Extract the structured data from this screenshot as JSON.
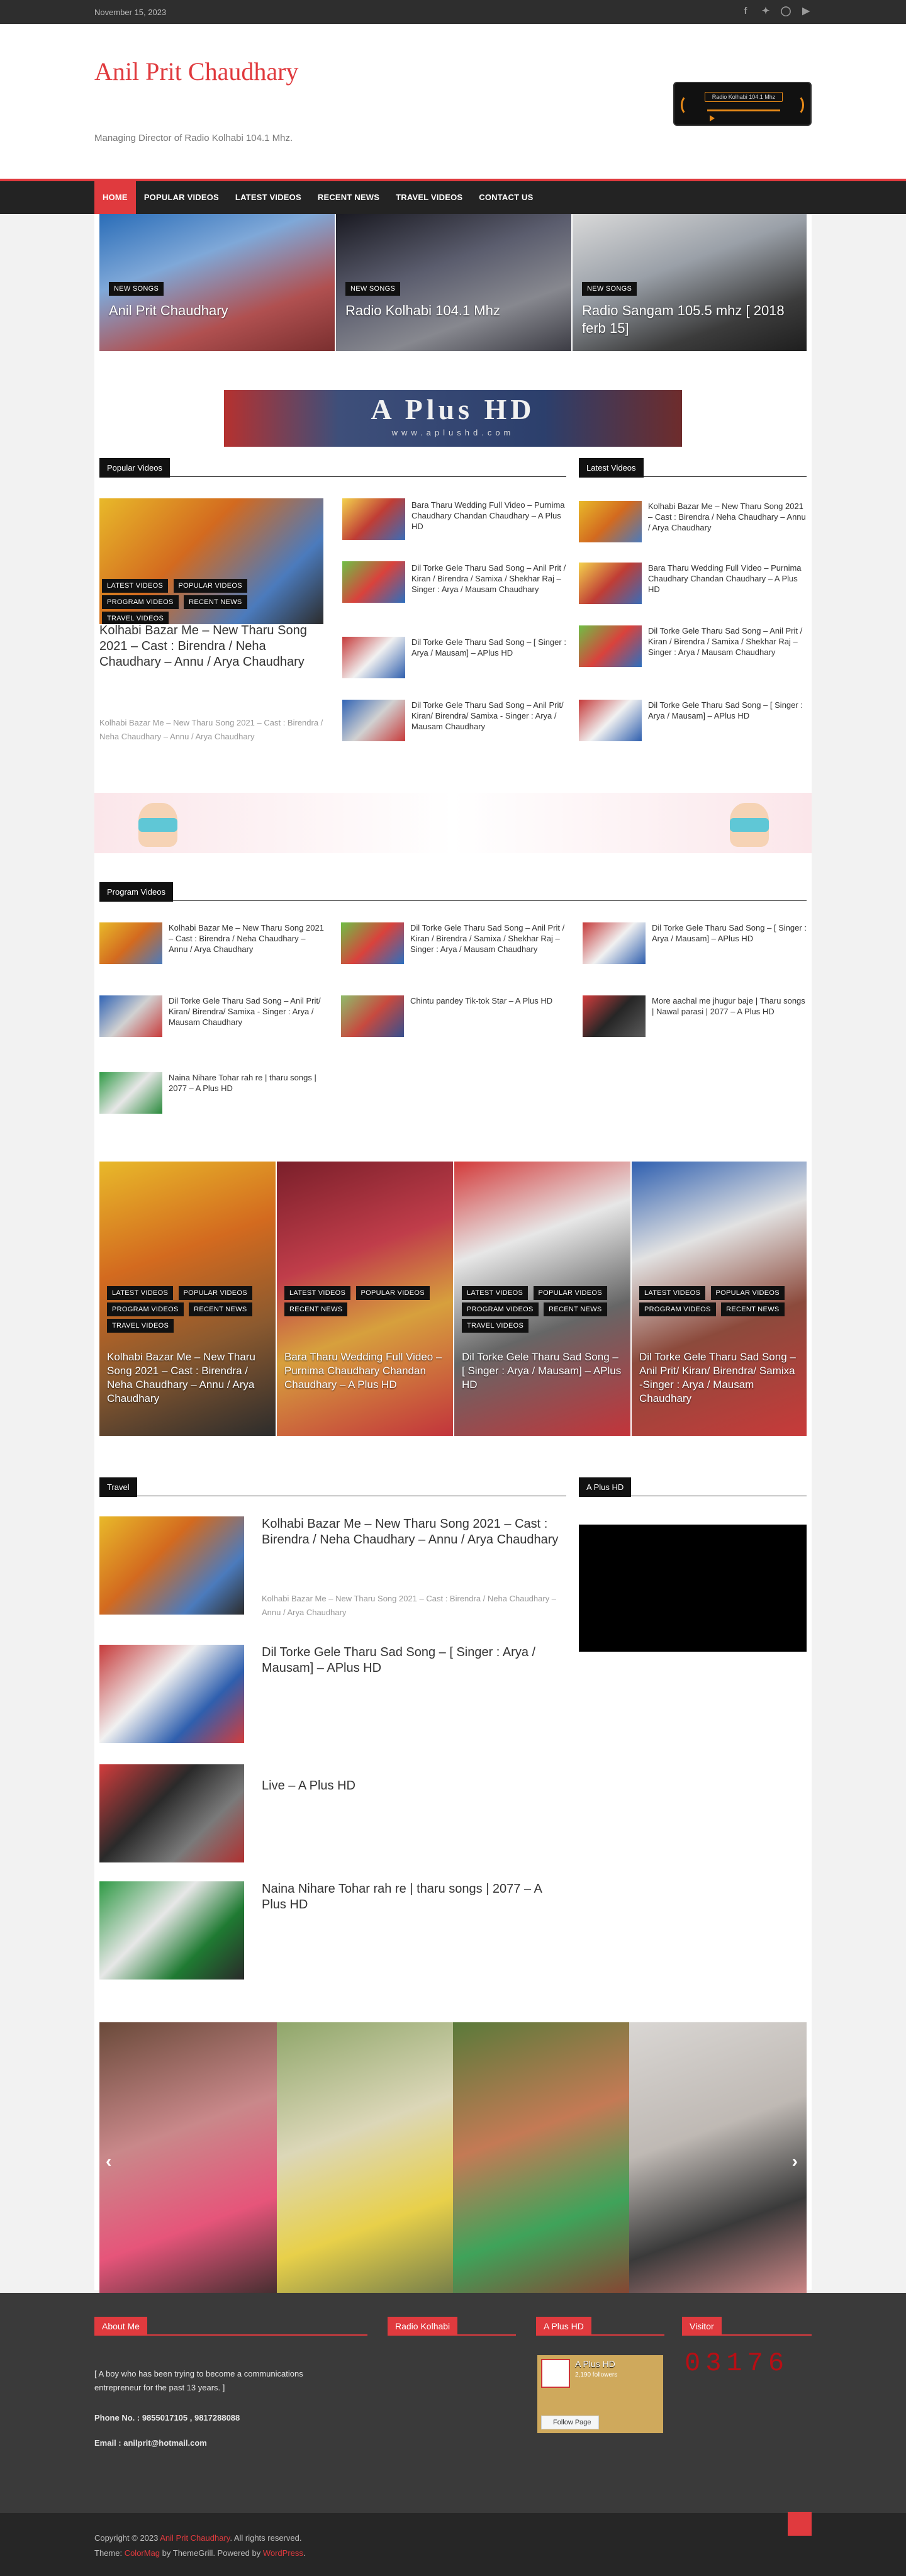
{
  "topbar": {
    "date": "November 15, 2023",
    "social": [
      "facebook-icon",
      "twitter-icon",
      "instagram-icon",
      "youtube-icon"
    ]
  },
  "header": {
    "title": "Anil Prit Chaudhary",
    "description": "Managing Director of Radio Kolhabi 104.1 Mhz.",
    "radio_label": "Radio Kolhabi 104.1 Mhz"
  },
  "nav": [
    "HOME",
    "POPULAR VIDEOS",
    "LATEST VIDEOS",
    "RECENT NEWS",
    "TRAVEL VIDEOS",
    "CONTACT US"
  ],
  "featured": [
    {
      "tag": "NEW SONGS",
      "title": "Anil Prit Chaudhary"
    },
    {
      "tag": "NEW SONGS",
      "title": "Radio Kolhabi 104.1 Mhz"
    },
    {
      "tag": "NEW SONGS",
      "title": "Radio Sangam 105.5 mhz [ 2018 ferb 15]"
    }
  ],
  "banner": {
    "title": "A Plus HD",
    "url": "www.aplushd.com"
  },
  "popular": {
    "heading": "Popular Videos",
    "main": {
      "tags": [
        "LATEST VIDEOS",
        "POPULAR VIDEOS",
        "PROGRAM VIDEOS",
        "RECENT NEWS",
        "TRAVEL VIDEOS"
      ],
      "title": "Kolhabi Bazar Me – New Tharu Song 2021 – Cast : Birendra / Neha Chaudhary – Annu / Arya Chaudhary",
      "excerpt": "Kolhabi Bazar Me – New Tharu Song 2021 – Cast : Birendra / Neha Chaudhary – Annu / Arya Chaudhary"
    },
    "list": [
      "Bara                    Tharu Wedding Full Video – Purnima Chaudhary Chandan Chaudhary – A Plus HD",
      "Dil Torke Gele Tharu Sad Song – Anil Prit / Kiran / Birendra / Samixa / Shekhar Raj – Singer : Arya / Mausam Chaudhary",
      "Dil Torke Gele Tharu Sad Song – [ Singer : Arya / Mausam] – APlus HD",
      "Dil Torke Gele Tharu Sad Song – Anil Prit/ Kiran/ Birendra/ Samixa - Singer : Arya / Mausam Chaudhary"
    ]
  },
  "latest": {
    "heading": "Latest Videos",
    "list": [
      "Kolhabi Bazar Me – New Tharu Song 2021 – Cast : Birendra / Neha Chaudhary – Annu / Arya Chaudhary",
      "Bara                 Tharu Wedding Full Video – Purnima Chaudhary Chandan Chaudhary – A Plus HD",
      "Dil Torke Gele Tharu Sad Song – Anil Prit / Kiran / Birendra / Samixa / Shekhar Raj – Singer : Arya / Mausam Chaudhary",
      "Dil Torke Gele Tharu Sad Song – [ Singer : Arya / Mausam] – APlus HD"
    ]
  },
  "program": {
    "heading": "Program Videos",
    "list": [
      "Kolhabi Bazar Me – New Tharu Song 2021 – Cast : Birendra / Neha Chaudhary – Annu / Arya Chaudhary",
      "Dil Torke Gele Tharu Sad Song – Anil Prit / Kiran / Birendra / Samixa / Shekhar Raj – Singer : Arya / Mausam Chaudhary",
      "Dil Torke Gele Tharu Sad Song – [ Singer : Arya / Mausam] – APlus HD",
      "Dil Torke Gele Tharu Sad Song – Anil Prit/ Kiran/ Birendra/ Samixa - Singer : Arya / Mausam Chaudhary",
      "Chintu pandey Tik-tok Star – A Plus HD",
      "More aachal me jhugur baje | Tharu songs | Nawal parasi | 2077 – A Plus HD",
      "Naina Nihare Tohar rah re | tharu songs | 2077 – A Plus HD"
    ]
  },
  "grid": [
    {
      "tags": [
        "LATEST VIDEOS",
        "POPULAR VIDEOS",
        "PROGRAM VIDEOS",
        "RECENT NEWS",
        "TRAVEL VIDEOS"
      ],
      "title": "Kolhabi Bazar Me – New Tharu Song 2021 – Cast : Birendra / Neha Chaudhary – Annu / Arya Chaudhary"
    },
    {
      "tags": [
        "LATEST VIDEOS",
        "POPULAR VIDEOS",
        "RECENT NEWS"
      ],
      "title": "Bara                 Tharu Wedding Full Video – Purnima Chaudhary Chandan Chaudhary – A Plus HD"
    },
    {
      "tags": [
        "LATEST VIDEOS",
        "POPULAR VIDEOS",
        "PROGRAM VIDEOS",
        "RECENT NEWS",
        "TRAVEL VIDEOS"
      ],
      "title": "Dil Torke Gele Tharu Sad Song – [ Singer : Arya / Mausam] – APlus HD"
    },
    {
      "tags": [
        "LATEST VIDEOS",
        "POPULAR VIDEOS",
        "PROGRAM VIDEOS",
        "RECENT NEWS"
      ],
      "title": "Dil Torke Gele Tharu Sad Song – Anil Prit/ Kiran/ Birendra/ Samixa -Singer : Arya / Mausam Chaudhary"
    }
  ],
  "travel": {
    "heading": "Travel",
    "items": [
      {
        "title": "Kolhabi Bazar Me – New Tharu Song 2021 – Cast : Birendra / Neha Chaudhary – Annu / Arya Chaudhary",
        "excerpt": "Kolhabi Bazar Me – New Tharu Song 2021 – Cast : Birendra / Neha Chaudhary – Annu / Arya Chaudhary"
      },
      {
        "title": "Dil Torke Gele Tharu Sad Song – [ Singer : Arya / Mausam] – APlus HD",
        "excerpt": ""
      },
      {
        "title": "Live                    – A Plus HD",
        "excerpt": ""
      },
      {
        "title": "Naina Nihare Tohar rah re | tharu songs | 2077 – A Plus HD",
        "excerpt": ""
      }
    ]
  },
  "aplus_sidebar": {
    "heading": "A Plus HD"
  },
  "footer": {
    "about_heading": "About Me",
    "about_text": "[ A boy who has been trying to become a communications entrepreneur for the past 13 years. ]",
    "phone": "Phone No. : 9855017105 , 9817288088",
    "email": "Email : anilprit@hotmail.com",
    "radio_heading": "Radio Kolhabi",
    "aplus_heading": "A Plus HD",
    "fb_name": "A Plus HD",
    "fb_followers": "2,190 followers",
    "fb_button": "Follow Page",
    "visitor_heading": "Visitor",
    "visitor_count": "03176"
  },
  "bottom": {
    "copyright_pre": "Copyright © 2023 ",
    "copyright_link": "Anil Prit Chaudhary",
    "copyright_post": ". All rights reserved.",
    "theme_pre": "Theme: ",
    "theme_link": "ColorMag",
    "theme_mid": " by ThemeGrill. Powered by ",
    "theme_wp": "WordPress",
    "theme_post": "."
  }
}
